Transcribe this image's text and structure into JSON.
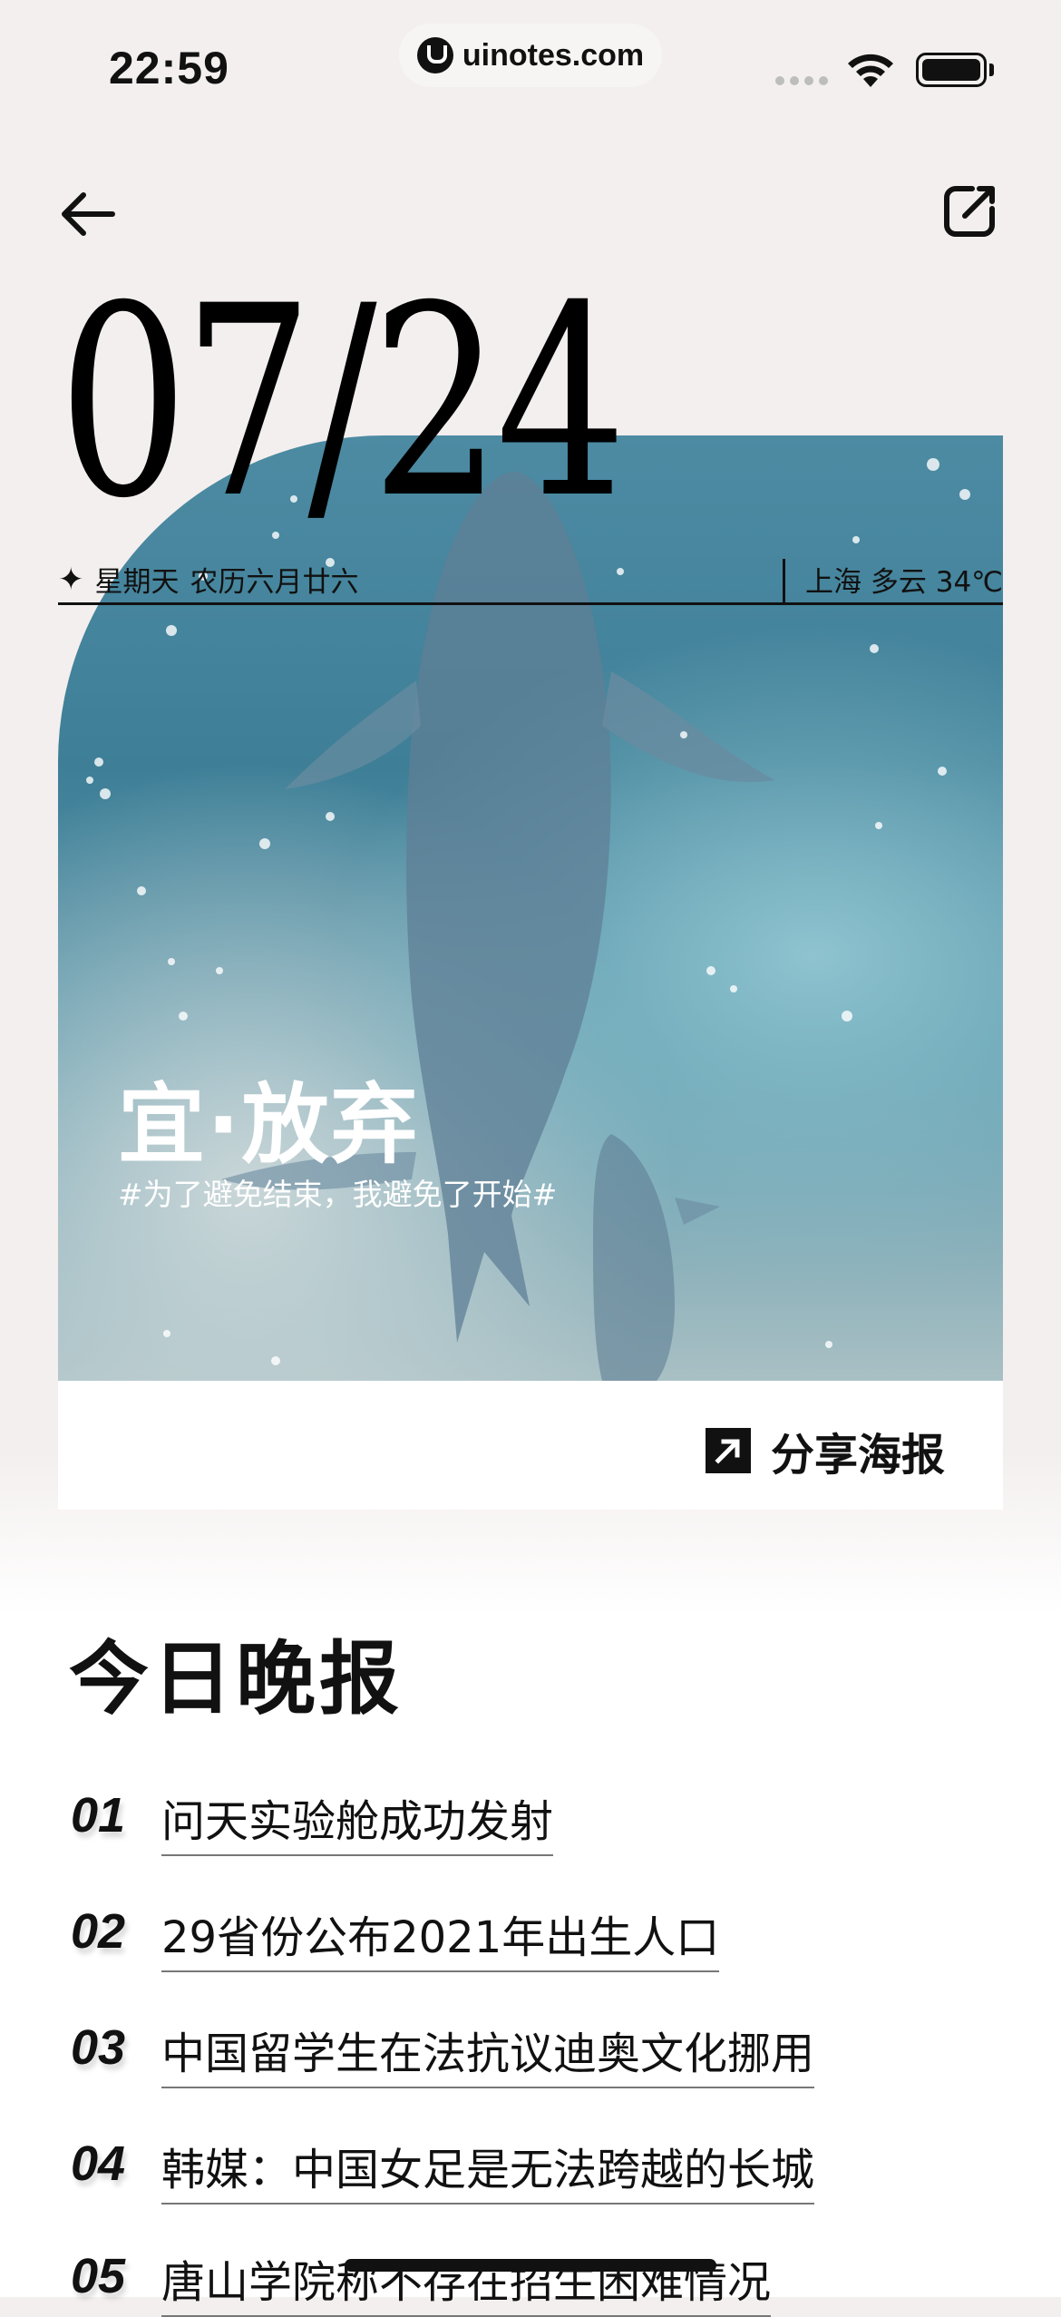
{
  "status_bar": {
    "time": "22:59",
    "url": "uinotes.com"
  },
  "nav": {
    "back_icon": "arrow-left-icon",
    "edit_icon": "edit-square-icon"
  },
  "card": {
    "date": "07/24",
    "weekday": "星期天",
    "lunar": "农历六月廿六",
    "city": "上海",
    "weather": "多云",
    "temp": "34℃",
    "yi": "宜·放弃",
    "quote": "#为了避免结束，我避免了开始#",
    "share_label": "分享海报"
  },
  "news": {
    "title": "今日晚报",
    "items": [
      {
        "num": "01",
        "title": "问天实验舱成功发射"
      },
      {
        "num": "02",
        "title": "29省份公布2021年出生人口"
      },
      {
        "num": "03",
        "title": "中国留学生在法抗议迪奥文化挪用"
      },
      {
        "num": "04",
        "title": "韩媒：中国女足是无法跨越的长城"
      },
      {
        "num": "05",
        "title": "唐山学院称不存在招生困难情况"
      }
    ]
  }
}
